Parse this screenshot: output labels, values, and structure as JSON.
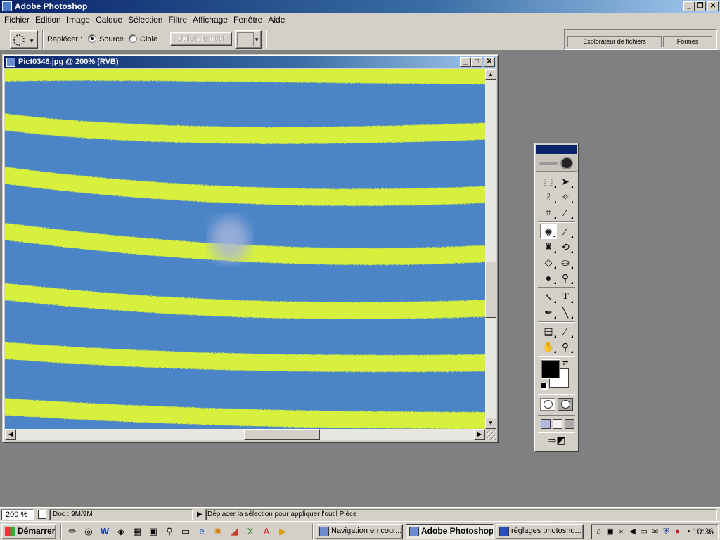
{
  "app": {
    "title": "Adobe Photoshop"
  },
  "window_controls": {
    "minimize": "_",
    "restore": "❐",
    "close": "✕"
  },
  "menu": [
    "Fichier",
    "Edition",
    "Image",
    "Calque",
    "Sélection",
    "Filtre",
    "Affichage",
    "Fenêtre",
    "Aide"
  ],
  "options": {
    "patch_label": "Rapiécer :",
    "source_label": "Source",
    "cible_label": "Cible",
    "use_pattern_label": "Utiliser le motif",
    "selected_mode": "Source",
    "palette_tabs": [
      "Explorateur de fichiers",
      "Formes"
    ]
  },
  "document": {
    "title": "Pict0346.jpg @ 200% (RVB)",
    "colors": {
      "blue": "#4b85c8",
      "yellow": "#d7ef3c",
      "spot": "#a8b6dc"
    }
  },
  "toolbox": {
    "tools": [
      "marquee-icon",
      "move-icon",
      "lasso-icon",
      "magic-wand-icon",
      "crop-icon",
      "slice-icon",
      "patch-icon",
      "brush-icon",
      "stamp-icon",
      "history-brush-icon",
      "eraser-icon",
      "bucket-icon",
      "blur-icon",
      "dodge-icon",
      "path-select-icon",
      "type-icon",
      "pen-icon",
      "line-icon",
      "notes-icon",
      "eyedropper-icon",
      "hand-icon",
      "zoom-icon"
    ],
    "foreground": "#000000",
    "background": "#ffffff"
  },
  "status": {
    "zoom": "200 %",
    "doc_size": "Doc : 9M/9M",
    "message": "Déplacer la sélection pour appliquer l'outil Pièce"
  },
  "taskbar": {
    "start_label": "Démarrer",
    "tasks": [
      {
        "label": "Navigation en cour...",
        "active": false
      },
      {
        "label": "Adobe Photoshop",
        "active": true
      },
      {
        "label": "réglages photosho...",
        "active": false
      }
    ],
    "clock": "10:36"
  }
}
